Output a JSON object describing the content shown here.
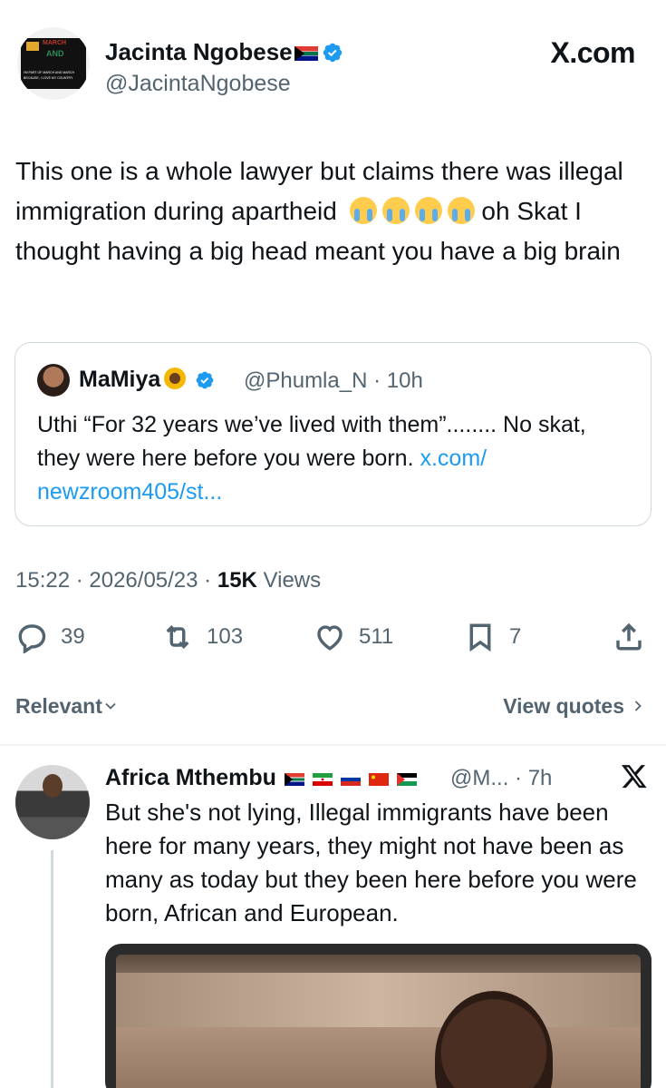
{
  "tweet": {
    "author_name": "Jacinta Ngobese",
    "author_handle": "@JacintaNgobese",
    "site": "X.com",
    "avatar_text": {
      "top": "MARCH",
      "middle": "AND",
      "line1": "I'M PART OF MARCH AND MARCH",
      "line2": "BECAUSE, I LOVE MY COUNTRY."
    },
    "text": "This one is a whole lawyer but claims there was illegal immigration during apartheid",
    "text_after": "oh Skat I thought having a big head meant you have a big brain",
    "emoji_icon": "loudly-crying-face",
    "timestamp": "15:22 · 2026/05/23 · ",
    "views_count": "15K",
    "views_label": " Views"
  },
  "quote": {
    "name": "MaMiya",
    "handle_time": "@Phumla_N · 10h",
    "text": "Uthi “For 32 years we’ve lived with them”........ No skat, they were here before you were born. ",
    "link": "x.com/ newzroom405/st..."
  },
  "actions": {
    "replies": "39",
    "reposts": "103",
    "likes": "511",
    "bookmarks": "7"
  },
  "sort": {
    "relevant": "Relevant",
    "view_quotes": "View quotes"
  },
  "reply": {
    "name": "Africa Mthembu",
    "meta": "@M... · 7h",
    "text": "But she's not lying, Illegal immigrants have been here for many years, they might not have been as many as today but they been here before you were born, African and European."
  },
  "colors": {
    "verified_blue": "#1d9bf0",
    "secondary_text": "#536471",
    "link": "#1d9bf0"
  }
}
